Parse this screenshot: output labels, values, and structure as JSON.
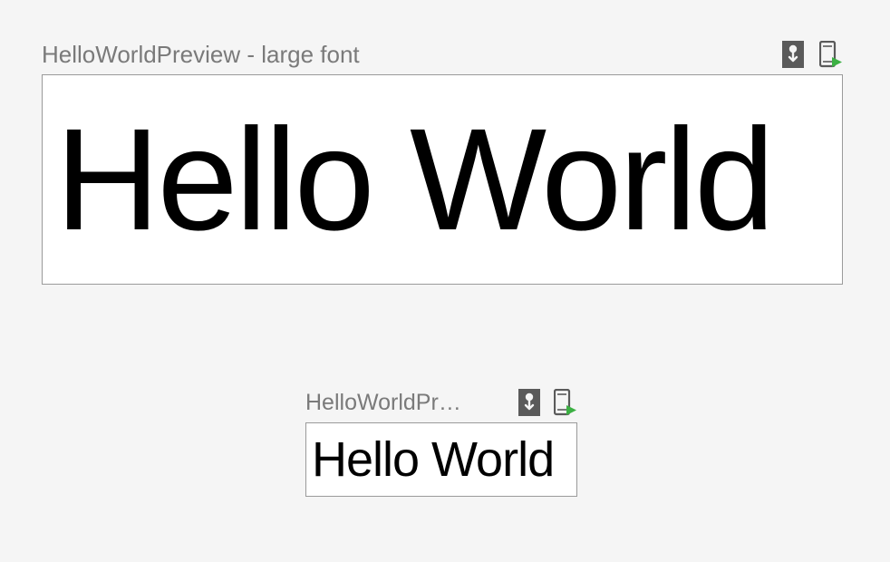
{
  "previews": {
    "large": {
      "title": "HelloWorldPreview - large font",
      "content": "Hello World"
    },
    "small": {
      "title": "HelloWorldPre...",
      "content": "Hello World"
    }
  },
  "icons": {
    "interactive_mode": "interactive-mode-icon",
    "deploy": "deploy-to-device-icon"
  },
  "colors": {
    "background": "#f5f5f5",
    "title_text": "#7a7a7a",
    "frame_border": "#9a9a9a",
    "frame_bg": "#ffffff",
    "content_text": "#000000",
    "icon_dark": "#5a5a5a",
    "icon_green": "#3cb043"
  }
}
